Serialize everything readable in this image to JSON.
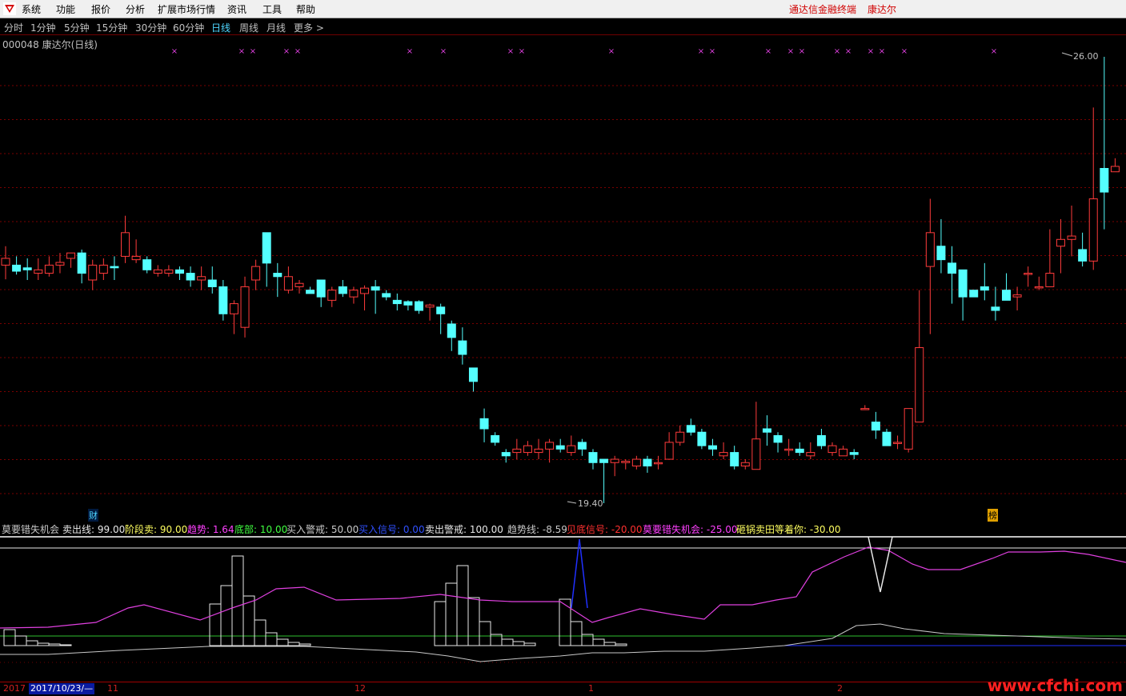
{
  "menubar": {
    "items": [
      "系统",
      "功能",
      "报价",
      "分析",
      "扩展市场行情",
      "资讯",
      "工具",
      "帮助"
    ],
    "brand_terminal": "通达信金融终端",
    "brand_stock": "康达尔"
  },
  "periods": {
    "items": [
      "分时",
      "1分钟",
      "5分钟",
      "15分钟",
      "30分钟",
      "60分钟",
      "日线",
      "周线",
      "月线",
      "更多 >"
    ],
    "active_index": 6
  },
  "stock": {
    "label": "000048 康达尔(日线)"
  },
  "main_chart": {
    "high_label": "26.00",
    "low_label": "19.40",
    "badge_cai": "财",
    "badge_bang": "榜",
    "colors": {
      "up": "#ff3b3b",
      "down": "#54ffff",
      "grid": "#7a0000",
      "marker": "#e040e0"
    },
    "candles": [
      [
        22.92,
        23.02,
        23.2,
        22.71
      ],
      [
        22.92,
        22.83,
        23.05,
        22.78
      ],
      [
        22.88,
        22.85,
        23.02,
        22.7
      ],
      [
        22.8,
        22.85,
        23.02,
        22.7
      ],
      [
        22.8,
        22.92,
        23.05,
        22.75
      ],
      [
        22.92,
        22.96,
        23.1,
        22.8
      ],
      [
        23.02,
        23.1,
        23.1,
        22.88
      ],
      [
        23.1,
        22.8,
        23.15,
        22.65
      ],
      [
        22.7,
        22.92,
        23.0,
        22.55
      ],
      [
        22.8,
        22.92,
        23.02,
        22.7
      ],
      [
        22.9,
        22.88,
        23.05,
        22.7
      ],
      [
        23.05,
        23.4,
        23.65,
        22.95
      ],
      [
        23.0,
        23.05,
        23.3,
        22.95
      ],
      [
        23.0,
        22.85,
        23.05,
        22.8
      ],
      [
        22.8,
        22.85,
        22.92,
        22.75
      ],
      [
        22.8,
        22.85,
        22.92,
        22.75
      ],
      [
        22.85,
        22.8,
        22.9,
        22.7
      ],
      [
        22.8,
        22.7,
        22.9,
        22.6
      ],
      [
        22.7,
        22.75,
        22.9,
        22.55
      ],
      [
        22.7,
        22.6,
        22.9,
        22.5
      ],
      [
        22.6,
        22.2,
        22.7,
        22.1
      ],
      [
        22.2,
        22.35,
        22.4,
        21.9
      ],
      [
        22.0,
        22.6,
        22.75,
        21.85
      ],
      [
        22.7,
        22.9,
        23.0,
        22.55
      ],
      [
        23.4,
        22.95,
        23.4,
        22.6
      ],
      [
        22.8,
        22.75,
        22.95,
        22.45
      ],
      [
        22.55,
        22.75,
        22.9,
        22.5
      ],
      [
        22.6,
        22.65,
        22.7,
        22.5
      ],
      [
        22.55,
        22.5,
        22.6,
        22.5
      ],
      [
        22.7,
        22.45,
        22.7,
        22.3
      ],
      [
        22.4,
        22.55,
        22.6,
        22.3
      ],
      [
        22.6,
        22.5,
        22.7,
        22.45
      ],
      [
        22.45,
        22.55,
        22.6,
        22.35
      ],
      [
        22.5,
        22.58,
        22.62,
        22.25
      ],
      [
        22.6,
        22.55,
        22.7,
        22.2
      ],
      [
        22.5,
        22.45,
        22.55,
        22.4
      ],
      [
        22.4,
        22.35,
        22.5,
        22.25
      ],
      [
        22.38,
        22.33,
        22.4,
        22.25
      ],
      [
        22.38,
        22.25,
        22.4,
        22.2
      ],
      [
        22.3,
        22.33,
        22.35,
        22.1
      ],
      [
        22.3,
        22.2,
        22.35,
        21.9
      ],
      [
        22.05,
        21.85,
        22.1,
        21.65
      ],
      [
        21.8,
        21.6,
        22.0,
        21.45
      ],
      [
        21.4,
        21.2,
        21.4,
        21.05
      ],
      [
        20.65,
        20.5,
        20.8,
        20.3
      ],
      [
        20.4,
        20.3,
        20.45,
        20.25
      ],
      [
        20.15,
        20.1,
        20.2,
        20.0
      ],
      [
        20.15,
        20.2,
        20.35,
        20.05
      ],
      [
        20.15,
        20.25,
        20.32,
        20.1
      ],
      [
        20.15,
        20.2,
        20.35,
        20.05
      ],
      [
        20.2,
        20.3,
        20.35,
        20.0
      ],
      [
        20.25,
        20.2,
        20.35,
        20.15
      ],
      [
        20.15,
        20.25,
        20.4,
        20.1
      ],
      [
        20.3,
        20.2,
        20.35,
        20.1
      ],
      [
        20.15,
        20.0,
        20.2,
        19.9
      ],
      [
        20.05,
        20.0,
        20.05,
        19.4
      ],
      [
        20.0,
        20.05,
        20.1,
        19.8
      ],
      [
        20.0,
        20.02,
        20.05,
        19.9
      ],
      [
        19.95,
        20.05,
        20.1,
        19.9
      ],
      [
        20.05,
        19.95,
        20.1,
        19.85
      ],
      [
        20.0,
        20.0,
        20.1,
        19.9
      ],
      [
        20.05,
        20.3,
        20.45,
        20.05
      ],
      [
        20.3,
        20.45,
        20.55,
        20.25
      ],
      [
        20.55,
        20.45,
        20.65,
        20.4
      ],
      [
        20.45,
        20.25,
        20.5,
        20.2
      ],
      [
        20.25,
        20.2,
        20.35,
        20.1
      ],
      [
        20.1,
        20.15,
        20.3,
        20.05
      ],
      [
        20.15,
        19.95,
        20.25,
        19.9
      ],
      [
        19.95,
        20.0,
        20.05,
        19.9
      ],
      [
        19.9,
        20.35,
        20.9,
        19.9
      ],
      [
        20.5,
        20.45,
        20.7,
        20.25
      ],
      [
        20.4,
        20.3,
        20.45,
        20.15
      ],
      [
        20.2,
        20.2,
        20.35,
        20.1
      ],
      [
        20.2,
        20.15,
        20.3,
        20.1
      ],
      [
        20.1,
        20.15,
        20.3,
        20.05
      ],
      [
        20.4,
        20.25,
        20.5,
        20.2
      ],
      [
        20.15,
        20.25,
        20.3,
        20.1
      ],
      [
        20.1,
        20.2,
        20.25,
        20.1
      ],
      [
        20.15,
        20.12,
        20.2,
        20.05
      ],
      [
        20.8,
        20.8,
        20.85,
        20.8
      ],
      [
        20.6,
        20.48,
        20.75,
        20.35
      ],
      [
        20.45,
        20.25,
        20.5,
        20.25
      ],
      [
        20.3,
        20.3,
        20.4,
        20.2
      ],
      [
        20.2,
        20.8,
        20.6,
        20.15
      ],
      [
        20.6,
        21.7,
        22.55,
        20.6
      ],
      [
        22.9,
        23.4,
        23.9,
        21.9
      ],
      [
        23.2,
        23.0,
        23.6,
        22.8
      ],
      [
        22.95,
        22.8,
        23.2,
        22.35
      ],
      [
        22.85,
        22.45,
        22.85,
        22.1
      ],
      [
        22.55,
        22.45,
        22.55,
        22.5
      ],
      [
        22.6,
        22.55,
        22.95,
        22.4
      ],
      [
        22.3,
        22.25,
        22.6,
        22.1
      ],
      [
        22.55,
        22.4,
        22.8,
        22.5
      ],
      [
        22.45,
        22.48,
        22.6,
        22.25
      ],
      [
        22.8,
        22.8,
        22.9,
        22.6
      ],
      [
        22.6,
        22.6,
        22.75,
        22.55
      ],
      [
        22.6,
        22.8,
        23.45,
        22.7
      ],
      [
        23.2,
        23.3,
        23.6,
        22.8
      ],
      [
        23.3,
        23.35,
        23.8,
        23.05
      ],
      [
        23.15,
        22.98,
        23.4,
        22.9
      ],
      [
        22.98,
        23.9,
        25.25,
        22.85
      ],
      [
        24.35,
        24.0,
        26.0,
        23.45
      ],
      [
        24.3,
        24.38,
        24.5,
        24.4
      ]
    ]
  },
  "indicator": {
    "legend": [
      {
        "text": "莫要错失机会",
        "color": "#c8c8c8"
      },
      {
        "text": "卖出线: 99.00",
        "color": "#e8e8e8"
      },
      {
        "text": "阶段卖: 90.00",
        "color": "#ffff60"
      },
      {
        "text": "趋势: 1.64",
        "color": "#ff40ff"
      },
      {
        "text": "底部: 10.00",
        "color": "#40ff40"
      },
      {
        "text": "买入警戒: 50.00",
        "color": "#c8c8c8"
      },
      {
        "text": "买入信号: 0.00",
        "color": "#3050ff"
      },
      {
        "text": "卖出警戒: 100.00",
        "color": "#e8e8e8"
      },
      {
        "text": "趋势线: -8.59",
        "color": "#c8c8c8"
      },
      {
        "text": "见底信号: -20.00",
        "color": "#ff3030"
      },
      {
        "text": "莫要错失机会: -25.00",
        "color": "#ff40ff"
      },
      {
        "text": "砸锅卖田等着你: -30.00",
        "color": "#ffff60"
      }
    ]
  },
  "timeline": {
    "year_label": "2017",
    "current_date": "2017/10/23/—",
    "months": [
      "11",
      "12",
      "1",
      "2"
    ]
  },
  "watermark": "www.cfchi.com"
}
